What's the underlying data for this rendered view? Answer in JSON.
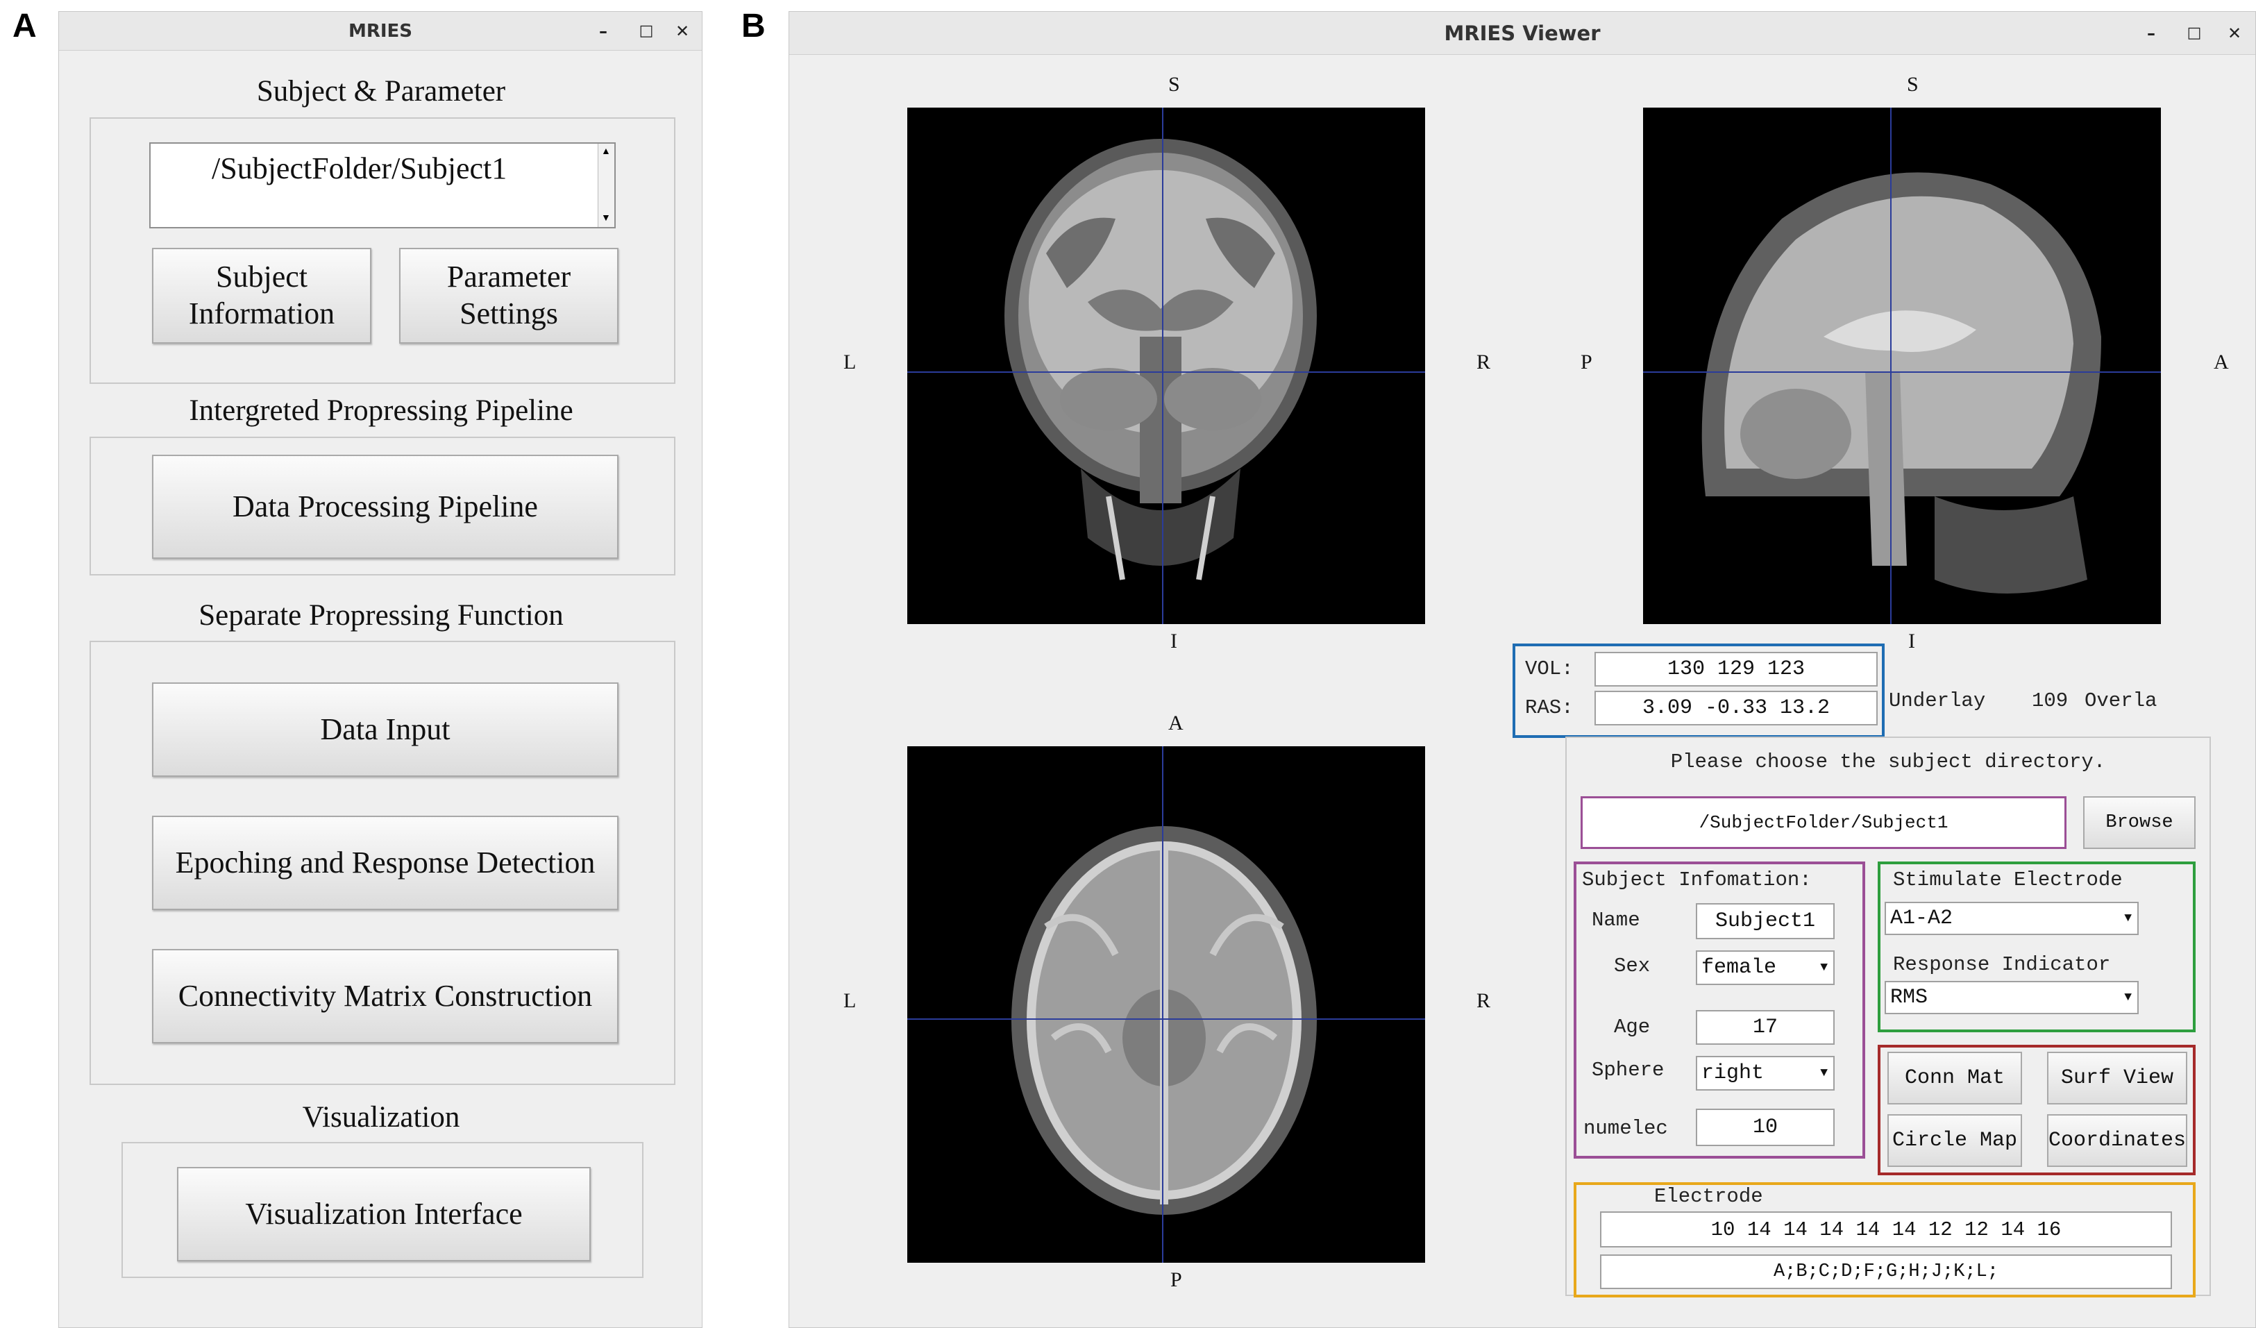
{
  "panel_a": {
    "letter": "A",
    "title": "MRIES",
    "controls": {
      "minimize": "–",
      "maximize": "□",
      "close": "✕"
    },
    "section1": {
      "title": "Subject & Parameter",
      "path_value": "/SubjectFolder/Subject1",
      "btn_subject_info": "Subject Information",
      "btn_parameter": "Parameter Settings"
    },
    "section2": {
      "title": "Intergreted Propressing Pipeline",
      "btn_pipeline": "Data Processing Pipeline"
    },
    "section3": {
      "title": "Separate Propressing Function",
      "btn_data_input": "Data Input",
      "btn_epoching": "Epoching and Response Detection",
      "btn_connectivity": "Connectivity Matrix Construction"
    },
    "section4": {
      "title": "Visualization",
      "btn_visualization": "Visualization Interface"
    }
  },
  "panel_b": {
    "letter": "B",
    "title": "MRIES Viewer",
    "controls": {
      "minimize": "–",
      "maximize": "□",
      "close": "✕"
    },
    "views": {
      "coronal": {
        "top": "S",
        "bottom": "I",
        "left": "L",
        "right": "R"
      },
      "sagittal": {
        "top": "S",
        "bottom": "I",
        "left": "P",
        "right": "A"
      },
      "axial": {
        "top": "A",
        "bottom": "P",
        "left": "L",
        "right": "R"
      }
    },
    "coords": {
      "vol_label": "VOL:",
      "vol_value": "130   129   123",
      "ras_label": "RAS:",
      "ras_value": "3.09   -0.33   13.2"
    },
    "underlay_label": "Underlay",
    "underlay_value": "109",
    "overlay_label": "Overla",
    "choose_prompt": "Please choose the subject directory.",
    "dir_value": "/SubjectFolder/Subject1",
    "browse_label": "Browse",
    "subject_info": {
      "title": "Subject Infomation:",
      "name_label": "Name",
      "name_value": "Subject1",
      "sex_label": "Sex",
      "sex_value": "female",
      "age_label": "Age",
      "age_value": "17",
      "sphere_label": "Sphere",
      "sphere_value": "right",
      "numelec_label": "numelec",
      "numelec_value": "10"
    },
    "stim": {
      "title": "Stimulate Electrode",
      "value": "A1-A2",
      "response_title": "Response Indicator",
      "response_value": "RMS"
    },
    "buttons": {
      "conn_mat": "Conn Mat",
      "surf_view": "Surf View",
      "circle_map": "Circle Map",
      "coordinates": "Coordinates"
    },
    "electrode": {
      "title": "Electrode",
      "numbers": "10   14   14   14   14   14   12   12   14   16",
      "letters": "A;B;C;D;F;G;H;J;K;L;"
    },
    "colors": {
      "crosshair": "#2b3c9a",
      "coords_box": "#1f6db3",
      "subject_box": "#9b4f96",
      "stim_box": "#2e9e3e",
      "buttons_box": "#a52a2a",
      "electrode_box": "#e8a81b"
    }
  }
}
